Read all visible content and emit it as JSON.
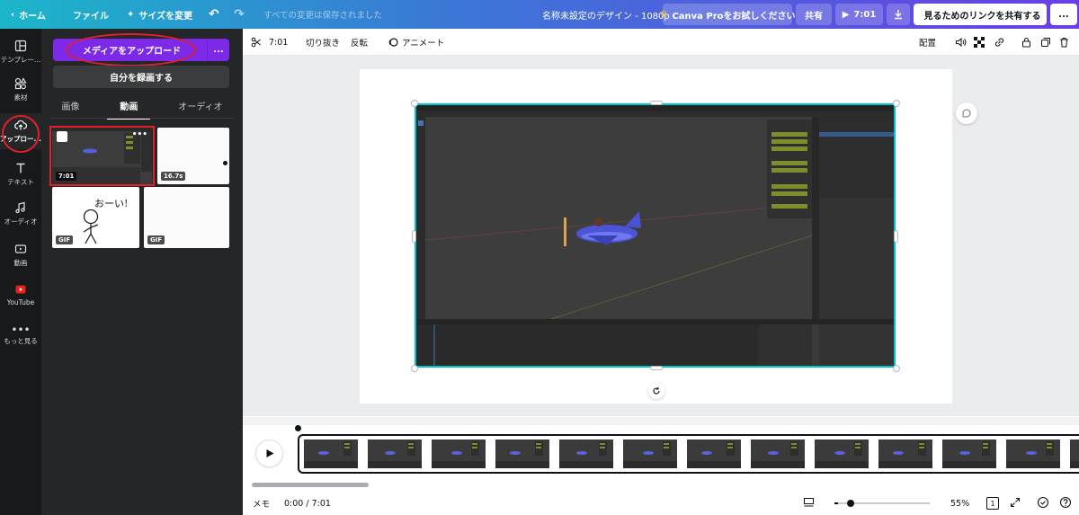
{
  "topbar": {
    "home": "ホーム",
    "file": "ファイル",
    "resize": "サイズを変更",
    "save_status": "すべての変更は保存されました",
    "design_title": "名称未設定のデザイン - 1080p",
    "pro_trial": "Canva Proをお試しください",
    "share": "共有",
    "play_duration": "7:01",
    "share_link": "見るためのリンクを共有する",
    "more": "..."
  },
  "sidebar": {
    "items": [
      {
        "label": "テンプレー..."
      },
      {
        "label": "素材"
      },
      {
        "label": "アップロー..."
      },
      {
        "label": "テキスト"
      },
      {
        "label": "オーディオ"
      },
      {
        "label": "動画"
      },
      {
        "label": "YouTube"
      },
      {
        "label": "もっと見る"
      }
    ]
  },
  "panel": {
    "upload_button": "メディアをアップロード",
    "upload_more": "...",
    "record_button": "自分を録画する",
    "tabs": [
      "画像",
      "動画",
      "オーディオ"
    ],
    "active_tab": "動画",
    "items": [
      {
        "badge": "7:01",
        "selected": true
      },
      {
        "badge": "16.7s"
      },
      {
        "badge": "GIF",
        "caption": "おーい!"
      },
      {
        "badge": "GIF"
      }
    ]
  },
  "toolbar": {
    "trim_time": "7:01",
    "crop": "切り抜き",
    "flip": "反転",
    "animate": "アニメート",
    "position": "配置"
  },
  "timeline": {
    "frame_count": 13
  },
  "bottombar": {
    "notes": "メモ",
    "time": "0:00 / 7:01",
    "zoom": "55%",
    "zoom_level": 0.1,
    "page_count": "1"
  },
  "colors": {
    "accent_purple": "#7d2ae8",
    "selection_teal": "#00c4cc",
    "annotation_red": "#e0202a"
  }
}
